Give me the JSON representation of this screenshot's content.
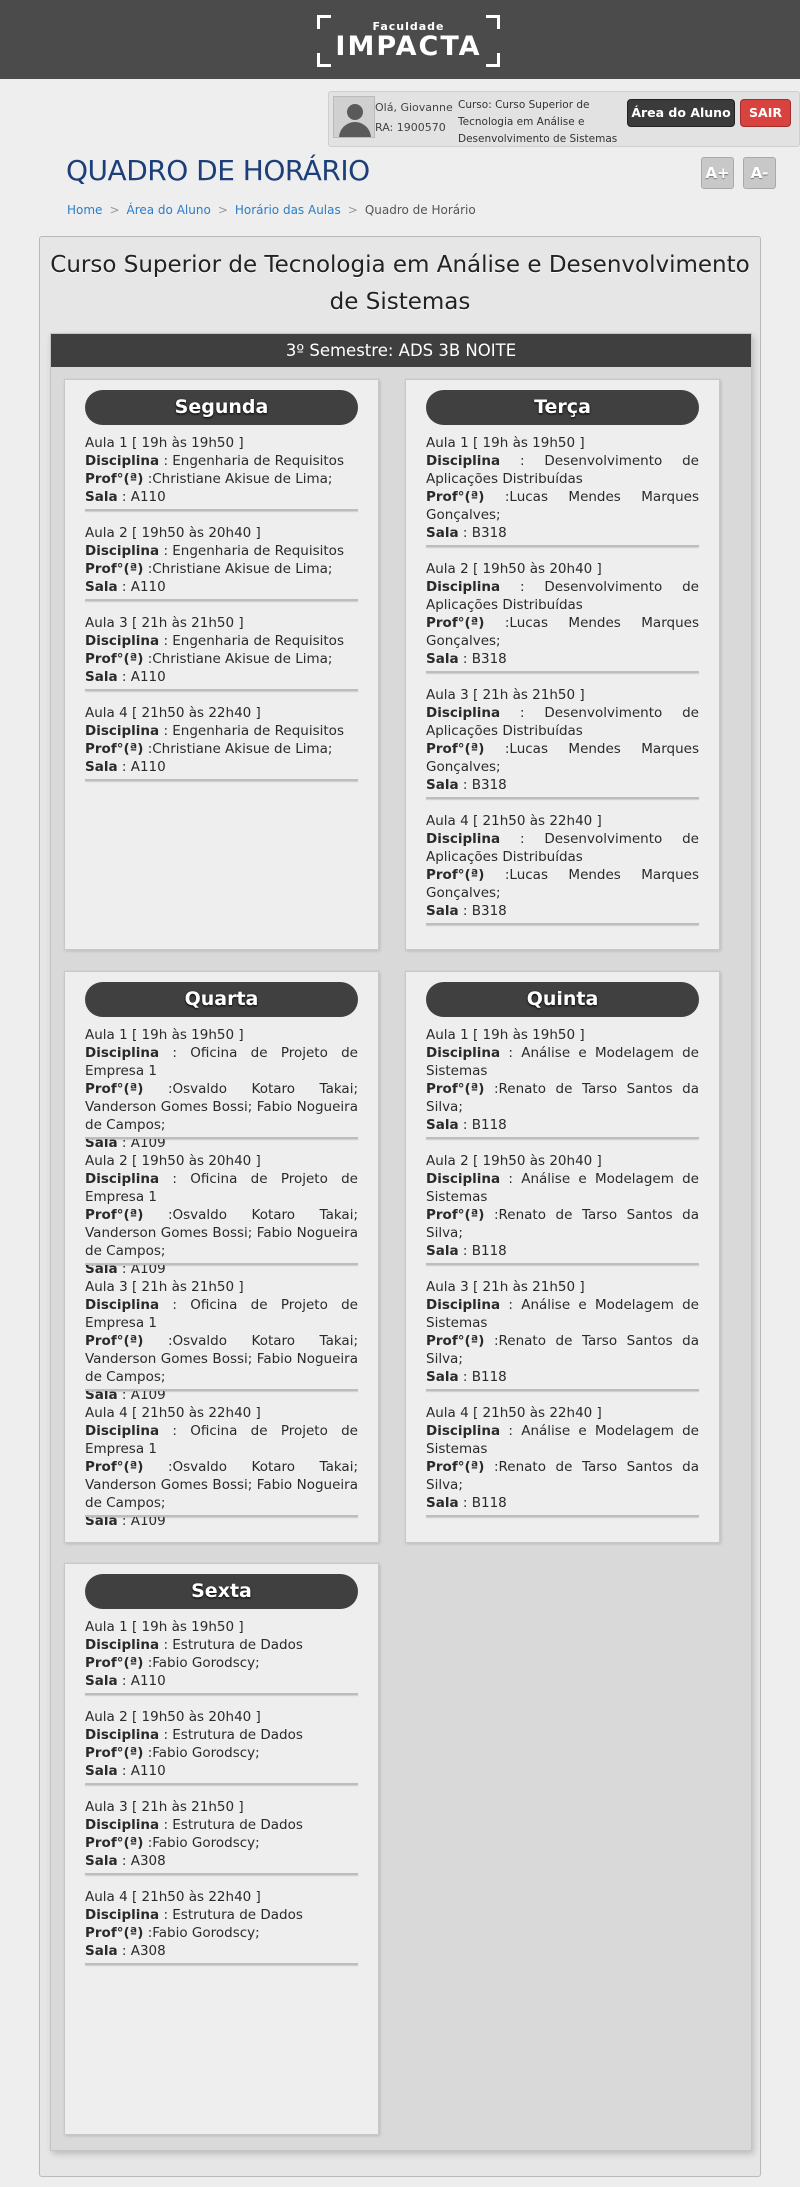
{
  "header": {
    "logo_small": "Faculdade",
    "logo_big": "IMPACTA"
  },
  "user": {
    "greeting": "Olá, Giovanne",
    "ra": "RA: 1900570",
    "course_label": "Curso:",
    "course_name": "Curso Superior de Tecnologia em Análise e Desenvolvimento de Sistemas",
    "btn_area": "Área do Aluno",
    "btn_sair": "SAIR"
  },
  "page": {
    "title": "QUADRO DE HORÁRIO",
    "font_increase": "A+",
    "font_decrease": "A-",
    "breadcrumb": [
      "Home",
      "Área do Aluno",
      "Horário das Aulas",
      "Quadro de Horário"
    ],
    "course_title": "Curso Superior de Tecnologia em Análise e Desenvolvimento de Sistemas",
    "semester": "3º Semestre: ADS 3B NOITE"
  },
  "labels": {
    "disciplina": "Disciplina",
    "prof": "Prof°(ª)",
    "sala": "Sala"
  },
  "days": [
    {
      "name": "Segunda",
      "aulas": [
        {
          "title": "Aula 1 [ 19h às 19h50 ]",
          "disciplina": ": Engenharia de Requisitos",
          "prof": ":Christiane Akisue de Lima;",
          "sala": ": A110"
        },
        {
          "title": "Aula 2 [ 19h50 às 20h40 ]",
          "disciplina": ": Engenharia de Requisitos",
          "prof": ":Christiane Akisue de Lima;",
          "sala": ": A110"
        },
        {
          "title": "Aula 3 [ 21h às 21h50 ]",
          "disciplina": ": Engenharia de Requisitos",
          "prof": ":Christiane Akisue de Lima;",
          "sala": ": A110"
        },
        {
          "title": "Aula 4 [ 21h50 às 22h40 ]",
          "disciplina": ": Engenharia de Requisitos",
          "prof": ":Christiane Akisue de Lima;",
          "sala": ": A110"
        }
      ]
    },
    {
      "name": "Terça",
      "aulas": [
        {
          "title": "Aula 1 [ 19h às 19h50 ]",
          "disciplina": ": Desenvolvimento de Aplicações Distribuídas",
          "prof": ":Lucas Mendes Marques Gonçalves;",
          "sala": ": B318"
        },
        {
          "title": "Aula 2 [ 19h50 às 20h40 ]",
          "disciplina": ": Desenvolvimento de Aplicações Distribuídas",
          "prof": ":Lucas Mendes Marques Gonçalves;",
          "sala": ": B318"
        },
        {
          "title": "Aula 3 [ 21h às 21h50 ]",
          "disciplina": ": Desenvolvimento de Aplicações Distribuídas",
          "prof": ":Lucas Mendes Marques Gonçalves;",
          "sala": ": B318"
        },
        {
          "title": "Aula 4 [ 21h50 às 22h40 ]",
          "disciplina": ": Desenvolvimento de Aplicações Distribuídas",
          "prof": ":Lucas Mendes Marques Gonçalves;",
          "sala": ": B318"
        }
      ]
    },
    {
      "name": "Quarta",
      "aulas": [
        {
          "title": "Aula 1 [ 19h às 19h50 ]",
          "disciplina": ": Oficina de Projeto de Empresa 1",
          "prof": ":Osvaldo Kotaro Takai; Vanderson Gomes Bossi; Fabio Nogueira de Campos;",
          "sala": ": A109"
        },
        {
          "title": "Aula 2 [ 19h50 às 20h40 ]",
          "disciplina": ": Oficina de Projeto de Empresa 1",
          "prof": ":Osvaldo Kotaro Takai; Vanderson Gomes Bossi; Fabio Nogueira de Campos;",
          "sala": ": A109"
        },
        {
          "title": "Aula 3 [ 21h às 21h50 ]",
          "disciplina": ": Oficina de Projeto de Empresa 1",
          "prof": ":Osvaldo Kotaro Takai; Vanderson Gomes Bossi; Fabio Nogueira de Campos;",
          "sala": ": A109"
        },
        {
          "title": "Aula 4 [ 21h50 às 22h40 ]",
          "disciplina": ": Oficina de Projeto de Empresa 1",
          "prof": ":Osvaldo Kotaro Takai; Vanderson Gomes Bossi; Fabio Nogueira de Campos;",
          "sala": ": A109"
        }
      ]
    },
    {
      "name": "Quinta",
      "aulas": [
        {
          "title": "Aula 1 [ 19h às 19h50 ]",
          "disciplina": ": Análise e Modelagem de Sistemas",
          "prof": ":Renato de Tarso Santos da Silva;",
          "sala": ": B118"
        },
        {
          "title": "Aula 2 [ 19h50 às 20h40 ]",
          "disciplina": ": Análise e Modelagem de Sistemas",
          "prof": ":Renato de Tarso Santos da Silva;",
          "sala": ": B118"
        },
        {
          "title": "Aula 3 [ 21h às 21h50 ]",
          "disciplina": ": Análise e Modelagem de Sistemas",
          "prof": ":Renato de Tarso Santos da Silva;",
          "sala": ": B118"
        },
        {
          "title": "Aula 4 [ 21h50 às 22h40 ]",
          "disciplina": ": Análise e Modelagem de Sistemas",
          "prof": ":Renato de Tarso Santos da Silva;",
          "sala": ": B118"
        }
      ]
    },
    {
      "name": "Sexta",
      "aulas": [
        {
          "title": "Aula 1 [ 19h às 19h50 ]",
          "disciplina": ": Estrutura de Dados",
          "prof": ":Fabio Gorodscy;",
          "sala": ": A110"
        },
        {
          "title": "Aula 2 [ 19h50 às 20h40 ]",
          "disciplina": ": Estrutura de Dados",
          "prof": ":Fabio Gorodscy;",
          "sala": ": A110"
        },
        {
          "title": "Aula 3 [ 21h às 21h50 ]",
          "disciplina": ": Estrutura de Dados",
          "prof": ":Fabio Gorodscy;",
          "sala": ": A308"
        },
        {
          "title": "Aula 4 [ 21h50 às 22h40 ]",
          "disciplina": ": Estrutura de Dados",
          "prof": ":Fabio Gorodscy;",
          "sala": ": A308"
        }
      ]
    }
  ]
}
